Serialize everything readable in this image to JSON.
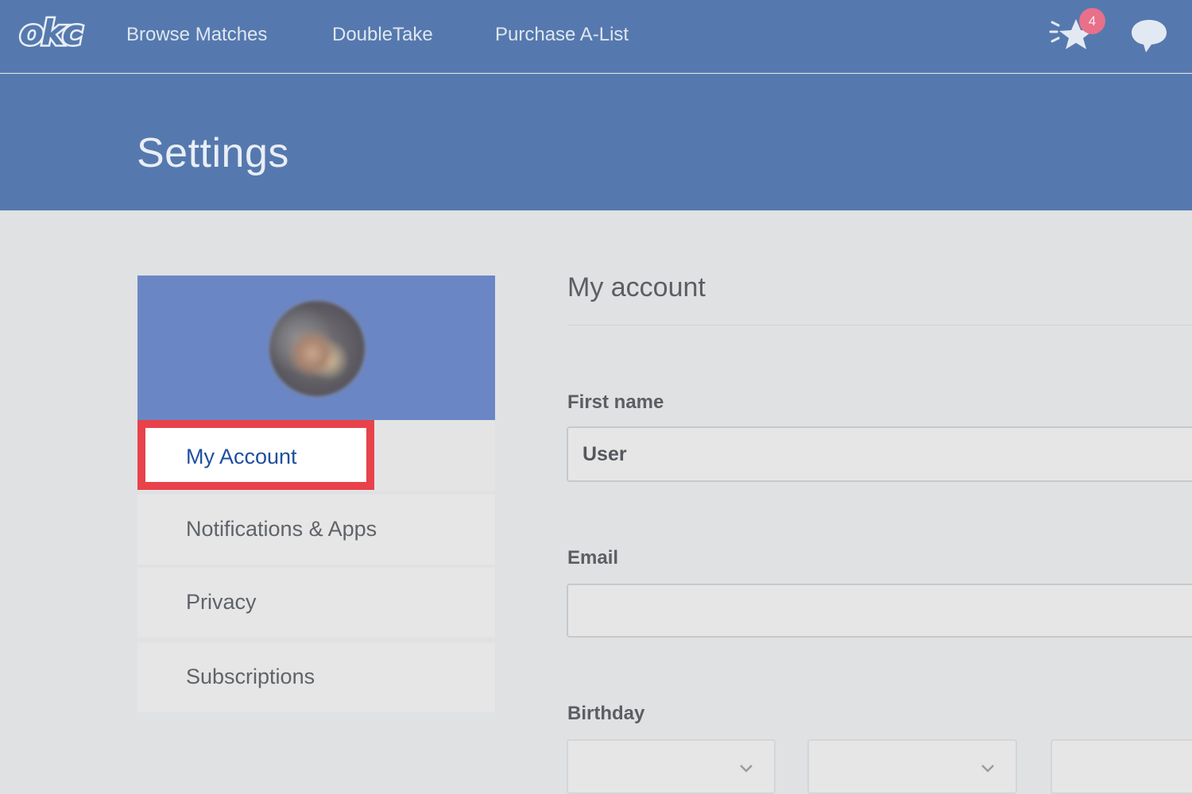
{
  "nav": {
    "logo_text": "okc",
    "links": [
      "Browse Matches",
      "DoubleTake",
      "Purchase A-List"
    ],
    "star_badge_count": "4",
    "star_icon": "star-icon",
    "chat_icon": "chat-bubble-icon"
  },
  "hero": {
    "title": "Settings"
  },
  "sidebar": {
    "avatar_icon": "profile-avatar",
    "items": [
      {
        "label": "My Account",
        "active": true
      },
      {
        "label": "Notifications & Apps",
        "active": false
      },
      {
        "label": "Privacy",
        "active": false
      },
      {
        "label": "Subscriptions",
        "active": false
      }
    ]
  },
  "main": {
    "section_title": "My account",
    "first_name": {
      "label": "First name",
      "value": "User"
    },
    "email": {
      "label": "Email",
      "value": ""
    },
    "birthday": {
      "label": "Birthday",
      "month": "",
      "day": "",
      "year": ""
    }
  },
  "colors": {
    "nav_bg": "#5579ae",
    "profile_card_bg": "#6b86c5",
    "highlight_border": "#e8424b",
    "active_link": "#1f4fa0",
    "badge_bg": "#e8708a",
    "page_bg": "#e0e1e3"
  }
}
